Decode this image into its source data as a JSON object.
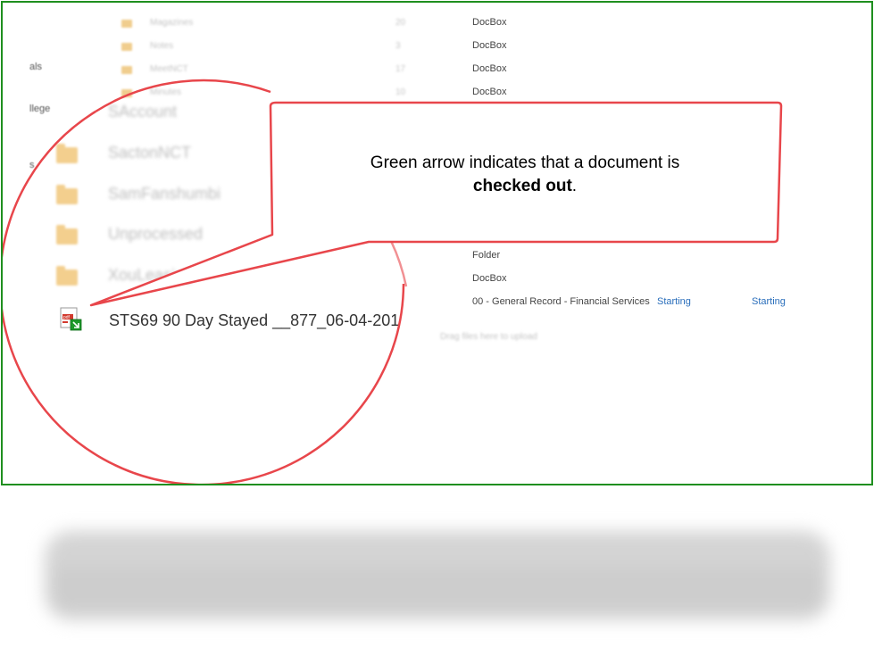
{
  "sidebar": {
    "items": [
      {
        "label": "als"
      },
      {
        "label": "llege"
      },
      {
        "label": "s"
      }
    ]
  },
  "small_rows": [
    {
      "name": "Magazines",
      "count": "20",
      "location": "DocBox"
    },
    {
      "name": "Notes",
      "count": "3",
      "location": "DocBox"
    },
    {
      "name": "MeetNCT",
      "count": "17",
      "location": "DocBox"
    },
    {
      "name": "Minutes",
      "count": "10",
      "location": "DocBox"
    }
  ],
  "big_rows": [
    {
      "name": "SAccount",
      "location": ""
    },
    {
      "name": "SactonNCT",
      "location": ""
    },
    {
      "name": "SamFanshumbi",
      "location": ""
    },
    {
      "name": "Unprocessed",
      "location": ""
    },
    {
      "name": "XouLeasing",
      "location": "Folder"
    },
    {
      "name": "",
      "location": "DocBox"
    }
  ],
  "document": {
    "name": "STS69 90 Day Stayed __877_06-04-201",
    "record_type": "00 - General Record - Financial Services",
    "status_1": "Starting",
    "status_2": "Starting",
    "icon": "pdf-checked-out-icon"
  },
  "drag_hint": "Drag files here to upload",
  "callout": {
    "line1": "Green arrow indicates that a document is",
    "bold": "checked out",
    "suffix": "."
  },
  "colors": {
    "frame": "#1f8f1f",
    "circle": "#e8464b",
    "arrow": "#1d9a2a",
    "link": "#2a6ebb"
  }
}
